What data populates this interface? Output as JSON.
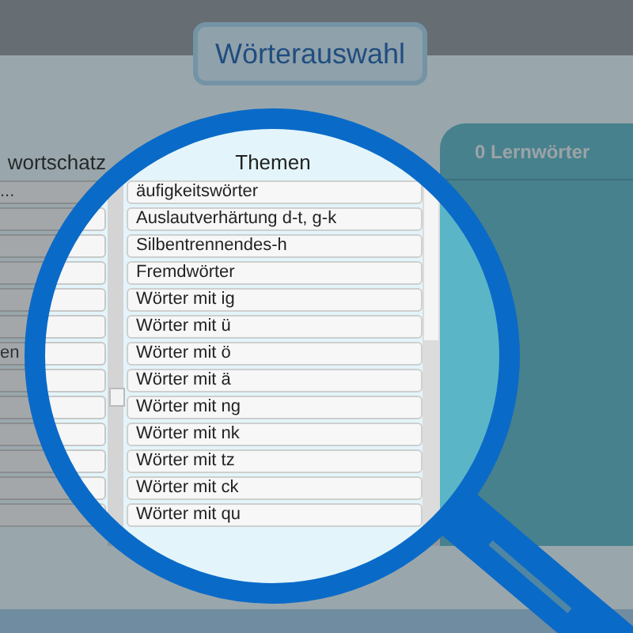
{
  "title": "Wörterauswahl",
  "left_list": {
    "header": "wortschatz",
    "rows": [
      {
        "text": "..."
      },
      {},
      {},
      {},
      {},
      {},
      {
        "text": "en"
      },
      {},
      {},
      {},
      {},
      {},
      {}
    ]
  },
  "themen": {
    "header": "Themen",
    "items": [
      "äufigkeitswörter",
      "Auslautverhärtung d-t, g-k",
      "Silbentrennendes-h",
      "Fremdwörter",
      "Wörter mit ig",
      "Wörter mit ü",
      "Wörter mit ö",
      "Wörter mit ä",
      "Wörter mit ng",
      "Wörter mit nk",
      "Wörter mit tz",
      "Wörter mit ck",
      "Wörter mit qu"
    ]
  },
  "lernwoerter": {
    "header": "0 Lernwörter"
  }
}
